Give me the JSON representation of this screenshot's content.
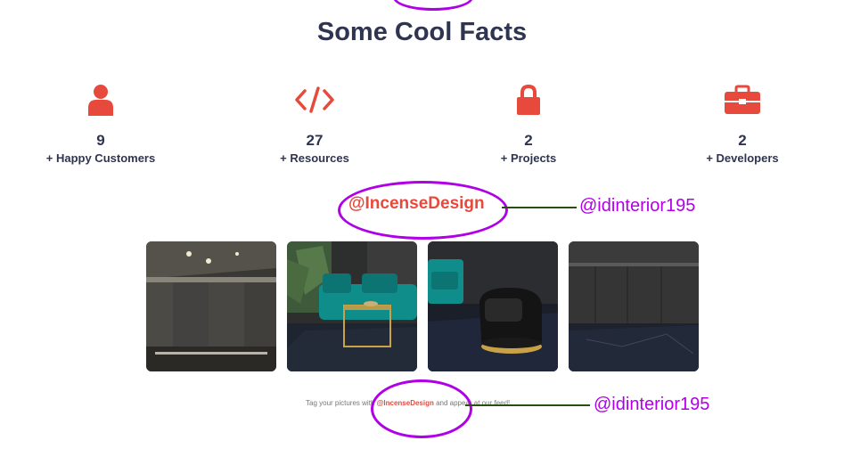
{
  "section": {
    "title": "Some Cool Facts"
  },
  "stats": [
    {
      "value": "9",
      "label": "+ Happy Customers",
      "icon": "user-icon"
    },
    {
      "value": "27",
      "label": "+ Resources",
      "icon": "code-icon"
    },
    {
      "value": "2",
      "label": "+ Projects",
      "icon": "lock-icon"
    },
    {
      "value": "2",
      "label": "+ Developers",
      "icon": "briefcase-icon"
    }
  ],
  "instagram": {
    "handle": "@IncenseDesign",
    "annotation_top": "@idinterior195",
    "annotation_bottom": "@idinterior195",
    "tag_prefix": "Tag your pictures with ",
    "tag_handle": "@IncenseDesign",
    "tag_suffix": " and appear at our feed!"
  },
  "colors": {
    "accent": "#e8493d",
    "heading": "#2f3550",
    "annotation": "#b000e6"
  }
}
